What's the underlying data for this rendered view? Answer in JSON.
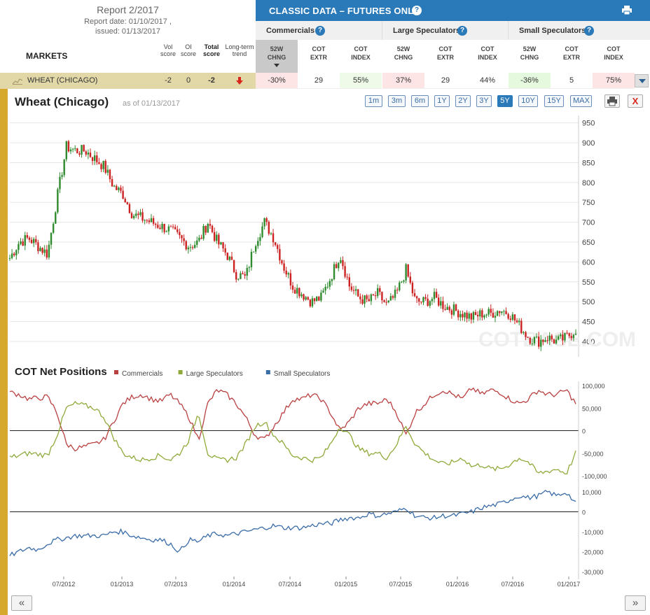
{
  "report": {
    "title": "Report 2/2017",
    "report_date": "Report date: 01/10/2017 ,",
    "issued": "issued: 01/13/2017",
    "markets_label": "MARKETS",
    "col_vol": [
      "Vol",
      "score"
    ],
    "col_oi": [
      "OI",
      "score"
    ],
    "col_total": [
      "Total",
      "score"
    ],
    "col_trend": [
      "Long-term",
      "trend"
    ]
  },
  "classic": {
    "title": "CLASSIC DATA – FUTURES ONLY",
    "groups": [
      {
        "label": "Commercials"
      },
      {
        "label": "Large Speculators"
      },
      {
        "label": "Small Speculators"
      }
    ],
    "sub_cols": [
      [
        "52W",
        "CHNG"
      ],
      [
        "COT",
        "EXTR"
      ],
      [
        "COT",
        "INDEX"
      ],
      [
        "52W",
        "CHNG"
      ],
      [
        "COT",
        "EXTR"
      ],
      [
        "COT",
        "INDEX"
      ],
      [
        "52W",
        "CHNG"
      ],
      [
        "COT",
        "EXTR"
      ],
      [
        "COT",
        "INDEX"
      ]
    ]
  },
  "wheat_row": {
    "name": "WHEAT (CHICAGO)",
    "vol_score": "-2",
    "oi_score": "0",
    "total_score": "-2",
    "values": [
      "-30%",
      "29",
      "55%",
      "37%",
      "29",
      "44%",
      "-36%",
      "5",
      "75%"
    ],
    "cell_colors": [
      "#fde5e5",
      "#ffffff",
      "#eefbe9",
      "#fde5e5",
      "#ffffff",
      "#ffffff",
      "#e5f9de",
      "#ffffff",
      "#fde5e5"
    ]
  },
  "chart": {
    "title": "Wheat (Chicago)",
    "asof": "as of 01/13/2017",
    "ranges": [
      "1m",
      "3m",
      "6m",
      "1Y",
      "2Y",
      "3Y",
      "5Y",
      "10Y",
      "15Y",
      "MAX"
    ],
    "active_range": "5Y",
    "close_label": "X"
  },
  "chart_data": [
    {
      "type": "candlestick",
      "title": "Wheat (Chicago)",
      "ylim": [
        370,
        960
      ],
      "yticks": [
        950,
        900,
        850,
        800,
        750,
        700,
        650,
        600,
        550,
        500,
        450,
        400
      ],
      "watermark": "COTBASE.COM",
      "x": [
        "2012-01",
        "2012-02",
        "2012-03",
        "2012-04",
        "2012-05",
        "2012-06",
        "2012-07",
        "2012-08",
        "2012-09",
        "2012-10",
        "2012-11",
        "2012-12",
        "2013-01",
        "2013-02",
        "2013-03",
        "2013-04",
        "2013-05",
        "2013-06",
        "2013-07",
        "2013-08",
        "2013-09",
        "2013-10",
        "2013-11",
        "2013-12",
        "2014-01",
        "2014-02",
        "2014-03",
        "2014-04",
        "2014-05",
        "2014-06",
        "2014-07",
        "2014-08",
        "2014-09",
        "2014-10",
        "2014-11",
        "2014-12",
        "2015-01",
        "2015-02",
        "2015-03",
        "2015-04",
        "2015-05",
        "2015-06",
        "2015-07",
        "2015-08",
        "2015-09",
        "2015-10",
        "2015-11",
        "2015-12",
        "2016-01",
        "2016-02",
        "2016-03",
        "2016-04",
        "2016-05",
        "2016-06",
        "2016-07",
        "2016-08",
        "2016-09",
        "2016-10",
        "2016-11",
        "2016-12",
        "2017-01"
      ],
      "close": [
        610,
        650,
        660,
        640,
        620,
        760,
        890,
        880,
        880,
        860,
        840,
        790,
        770,
        720,
        710,
        700,
        690,
        680,
        660,
        640,
        650,
        700,
        650,
        620,
        570,
        560,
        650,
        700,
        660,
        590,
        540,
        520,
        500,
        510,
        560,
        620,
        540,
        510,
        500,
        520,
        490,
        520,
        580,
        500,
        500,
        510,
        490,
        480,
        470,
        460,
        470,
        470,
        480,
        470,
        440,
        410,
        400,
        410,
        400,
        410,
        430
      ]
    },
    {
      "type": "line",
      "title": "COT Net Positions",
      "series": [
        {
          "name": "Commercials",
          "color": "#b94040"
        },
        {
          "name": "Large Speculators",
          "color": "#8faa3a"
        },
        {
          "name": "Small Speculators",
          "color": "#3a6ca8"
        }
      ],
      "upper_yticks": [
        "100,000",
        "50,000",
        "0",
        "-50,000",
        "-100,000"
      ],
      "lower_yticks": [
        "10,000",
        "0",
        "-10,000",
        "-20,000",
        "-30,000"
      ],
      "xticks": [
        "07/2012",
        "01/2013",
        "07/2013",
        "01/2014",
        "07/2014",
        "01/2015",
        "07/2015",
        "01/2016",
        "07/2016",
        "01/2017"
      ],
      "x": [
        "2012-01",
        "2012-02",
        "2012-03",
        "2012-04",
        "2012-05",
        "2012-06",
        "2012-07",
        "2012-08",
        "2012-09",
        "2012-10",
        "2012-11",
        "2012-12",
        "2013-01",
        "2013-02",
        "2013-03",
        "2013-04",
        "2013-05",
        "2013-06",
        "2013-07",
        "2013-08",
        "2013-09",
        "2013-10",
        "2013-11",
        "2013-12",
        "2014-01",
        "2014-02",
        "2014-03",
        "2014-04",
        "2014-05",
        "2014-06",
        "2014-07",
        "2014-08",
        "2014-09",
        "2014-10",
        "2014-11",
        "2014-12",
        "2015-01",
        "2015-02",
        "2015-03",
        "2015-04",
        "2015-05",
        "2015-06",
        "2015-07",
        "2015-08",
        "2015-09",
        "2015-10",
        "2015-11",
        "2015-12",
        "2016-01",
        "2016-02",
        "2016-03",
        "2016-04",
        "2016-05",
        "2016-06",
        "2016-07",
        "2016-08",
        "2016-09",
        "2016-10",
        "2016-11",
        "2016-12",
        "2017-01"
      ],
      "commercials": [
        85000,
        80000,
        70000,
        72000,
        75000,
        40000,
        -30000,
        -40000,
        -35000,
        -30000,
        -20000,
        20000,
        60000,
        75000,
        80000,
        70000,
        65000,
        80000,
        60000,
        30000,
        -20000,
        60000,
        90000,
        80000,
        60000,
        30000,
        -10000,
        -20000,
        10000,
        40000,
        70000,
        70000,
        80000,
        70000,
        40000,
        0,
        20000,
        50000,
        60000,
        60000,
        70000,
        40000,
        -10000,
        40000,
        60000,
        80000,
        90000,
        80000,
        70000,
        95000,
        80000,
        90000,
        85000,
        70000,
        60000,
        70000,
        90000,
        80000,
        80000,
        90000,
        60000
      ],
      "large_specs": [
        -60000,
        -55000,
        -50000,
        -52000,
        -55000,
        -10000,
        50000,
        60000,
        55000,
        50000,
        30000,
        -15000,
        -50000,
        -60000,
        -65000,
        -60000,
        -55000,
        -65000,
        -50000,
        -20000,
        40000,
        -50000,
        -65000,
        -65000,
        -60000,
        -30000,
        10000,
        20000,
        -10000,
        -30000,
        -55000,
        -60000,
        -65000,
        -60000,
        -30000,
        10000,
        -10000,
        -40000,
        -50000,
        -50000,
        -60000,
        -30000,
        10000,
        -30000,
        -50000,
        -65000,
        -75000,
        -70000,
        -60000,
        -80000,
        -75000,
        -85000,
        -85000,
        -75000,
        -60000,
        -70000,
        -95000,
        -90000,
        -85000,
        -95000,
        -50000
      ],
      "small_specs": [
        -22000,
        -20000,
        -18000,
        -19000,
        -16000,
        -14000,
        -13000,
        -12000,
        -12000,
        -12000,
        -12000,
        -10000,
        -10000,
        -12000,
        -13000,
        -14000,
        -14000,
        -16000,
        -20000,
        -14000,
        -15000,
        -12000,
        -11000,
        -12000,
        -11000,
        -10000,
        -9000,
        -8000,
        -7000,
        -8000,
        -8000,
        -8000,
        -7000,
        -6000,
        -6000,
        -4000,
        -3000,
        -3000,
        -1000,
        -2000,
        -1000,
        0,
        2000,
        -2000,
        -3000,
        -3000,
        -2000,
        -2000,
        -1000,
        0,
        2000,
        3000,
        4000,
        6000,
        8000,
        7000,
        8000,
        10000,
        8000,
        10000,
        4000
      ]
    }
  ]
}
